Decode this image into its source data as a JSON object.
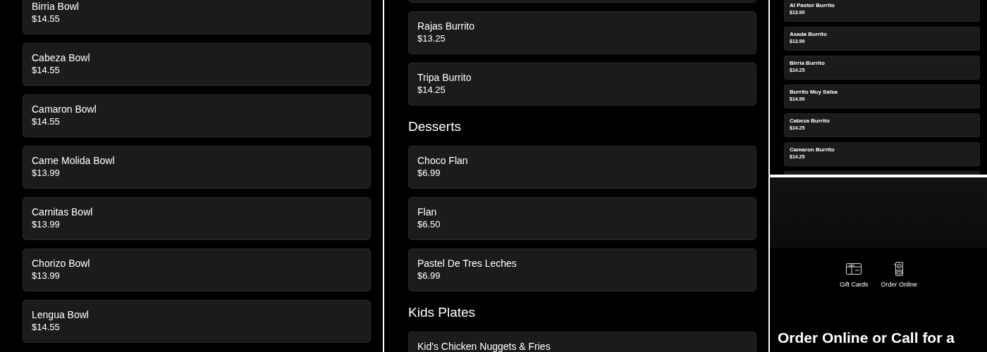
{
  "left_menu": {
    "entries": [
      {
        "kind": "item",
        "name": "Birria Bowl",
        "price": "$14.55"
      },
      {
        "kind": "item",
        "name": "Cabeza Bowl",
        "price": "$14.55"
      },
      {
        "kind": "item",
        "name": "Camaron Bowl",
        "price": "$14.55"
      },
      {
        "kind": "item",
        "name": "Carne Molida Bowl",
        "price": "$13.99"
      },
      {
        "kind": "item",
        "name": "Carnitas Bowl",
        "price": "$13.99"
      },
      {
        "kind": "item",
        "name": "Chorizo Bowl",
        "price": "$13.99"
      },
      {
        "kind": "item",
        "name": "Lengua Bowl",
        "price": "$14.55"
      }
    ]
  },
  "middle_menu": {
    "entries": [
      {
        "kind": "item",
        "name": "Rajas Burrito",
        "price": "$13.25"
      },
      {
        "kind": "item",
        "name": "Tripa Burrito",
        "price": "$14.25"
      },
      {
        "kind": "heading",
        "name": "Desserts"
      },
      {
        "kind": "item",
        "name": "Choco Flan",
        "price": "$6.99"
      },
      {
        "kind": "item",
        "name": "Flan",
        "price": "$6.50"
      },
      {
        "kind": "item",
        "name": "Pastel De Tres Leches",
        "price": "$6.99"
      },
      {
        "kind": "heading",
        "name": "Kids Plates"
      },
      {
        "kind": "item",
        "name": "Kid's Chicken Nuggets & Fries"
      }
    ]
  },
  "small_menu": {
    "entries": [
      {
        "kind": "item",
        "name": "Al Pastor Burrito",
        "price": "$13.99"
      },
      {
        "kind": "item",
        "name": "Asada Burrito",
        "price": "$13.99"
      },
      {
        "kind": "item",
        "name": "Birria Burrito",
        "price": "$14.25"
      },
      {
        "kind": "item",
        "name": "Burrito Muy Salsa",
        "price": "$14.99"
      },
      {
        "kind": "item",
        "name": "Cabeza Burrito",
        "price": "$14.25"
      },
      {
        "kind": "item",
        "name": "Camaron Burrito",
        "price": "$14.25"
      }
    ]
  },
  "footer": {
    "links": [
      {
        "kind": "gift",
        "label": "Gift Cards"
      },
      {
        "kind": "order",
        "label": "Order Online"
      }
    ],
    "heading": "Order Online or Call for a"
  }
}
